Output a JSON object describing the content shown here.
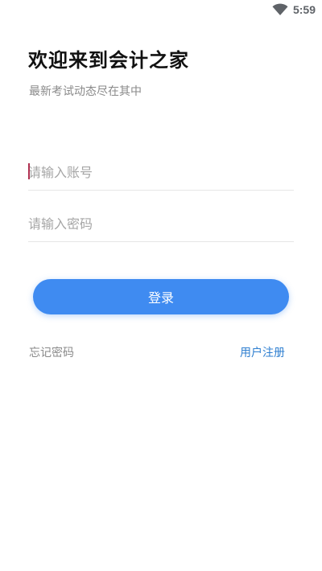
{
  "status_bar": {
    "time": "5:59",
    "wifi_icon": "wifi-icon"
  },
  "header": {
    "title": "欢迎来到会计之家",
    "subtitle": "最新考试动态尽在其中"
  },
  "form": {
    "account_placeholder": "请输入账号",
    "account_value": "",
    "password_placeholder": "请输入密码",
    "password_value": "",
    "login_label": "登录"
  },
  "links": {
    "forgot_password": "忘记密码",
    "register": "用户注册"
  },
  "colors": {
    "primary": "#3f8bf1",
    "link": "#2f7fd0",
    "muted_text": "#8a8a8a",
    "cursor": "#b03050"
  }
}
